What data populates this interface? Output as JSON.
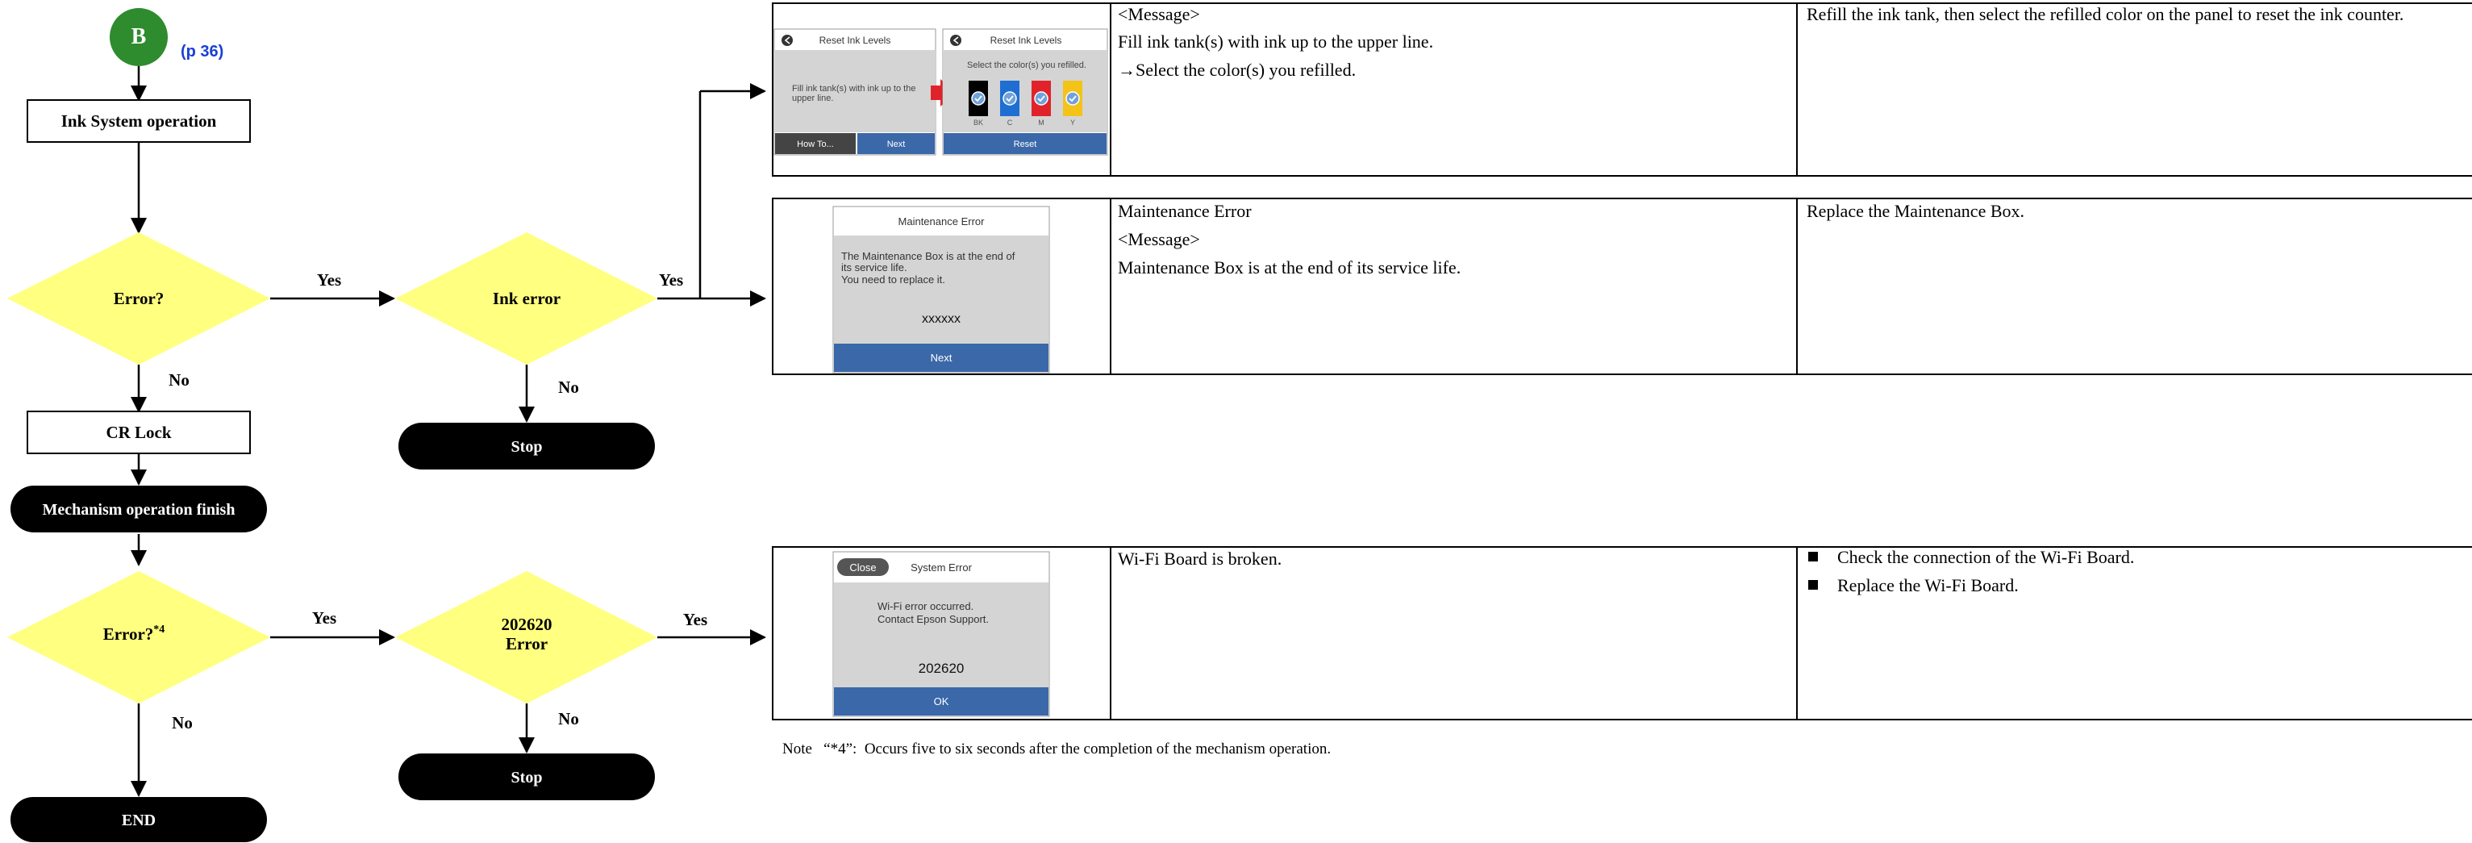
{
  "start_badge": {
    "letter": "B",
    "page_ref": "(p 36)",
    "color": "#2e8b2e",
    "ref_color": "#1a3fd6"
  },
  "nodes": {
    "ink_system": "Ink System operation",
    "error1": "Error?",
    "ink_error": "Ink error",
    "cr_lock": "CR Lock",
    "mech_finish": "Mechanism operation finish",
    "error2_main": "Error?",
    "error2_sup": "*4",
    "err202620_line1": "202620",
    "err202620_line2": "Error",
    "stop1": "Stop",
    "stop2": "Stop",
    "end": "END"
  },
  "labels": {
    "yes": "Yes",
    "no": "No"
  },
  "colors": {
    "diamond": "#ffff80",
    "terminal": "#000000",
    "button_blue": "#3b68a8",
    "screen_bg": "#d4d4d4"
  },
  "rows": [
    {
      "screens": [
        {
          "title": "Reset Ink Levels",
          "body": "Fill ink tank(s) with ink up to the upper line.",
          "buttons": [
            "How To...",
            "Next"
          ]
        },
        {
          "title": "Reset Ink Levels",
          "body": "Select the color(s) you refilled.",
          "inks": [
            "BK",
            "C",
            "M",
            "Y"
          ],
          "ink_colors": [
            "#000000",
            "#1e6fd1",
            "#e0232a",
            "#f3c318"
          ],
          "button": "Reset"
        }
      ],
      "message": [
        "<Message>",
        "Fill ink tank(s) with ink up to the upper line.",
        "→Select the color(s) you refilled."
      ],
      "remedy": [
        "Refill the ink tank, then select the refilled color on the panel to reset the ink counter."
      ]
    },
    {
      "screen": {
        "title": "Maintenance Error",
        "body": [
          "The Maintenance Box is at the end of",
          "its service life.",
          "You need to replace it."
        ],
        "code": "xxxxxx",
        "button": "Next"
      },
      "message": [
        "Maintenance Error",
        "<Message>",
        "Maintenance Box is at the end of its service life."
      ],
      "remedy": [
        "Replace the Maintenance Box."
      ]
    },
    {
      "screen": {
        "close": "Close",
        "title": "System Error",
        "body": [
          "Wi-Fi error occurred.",
          "Contact Epson Support."
        ],
        "code": "202620",
        "button": "OK"
      },
      "message": [
        "Wi-Fi Board is broken."
      ],
      "remedy": [
        "Check the connection of the Wi-Fi Board.",
        "Replace the Wi-Fi Board."
      ]
    }
  ],
  "note": "Note   “*4”:  Occurs five to six seconds after the completion of the mechanism operation."
}
